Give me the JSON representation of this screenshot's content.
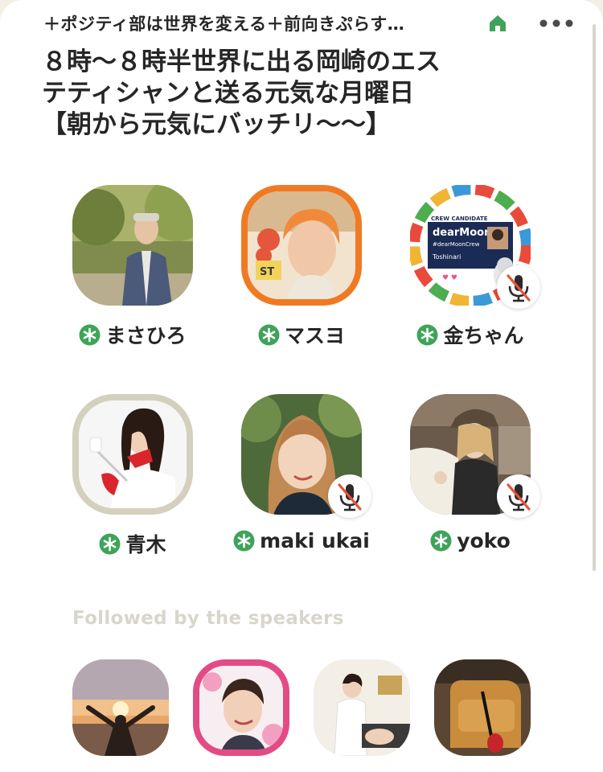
{
  "room": {
    "club_name": "＋ポジティ部は世界を変える＋前向きぷらす…",
    "title_lines": [
      "８時〜８時半世界に出る岡崎のエス",
      "テティシャンと送る元気な月曜日",
      "【朝から元気にバッチリ〜〜】"
    ]
  },
  "speakers": [
    {
      "name": "まさひろ",
      "muted": false
    },
    {
      "name": "マスヨ",
      "muted": false
    },
    {
      "name": "金ちゃん",
      "muted": true
    },
    {
      "name": "青木",
      "muted": false
    },
    {
      "name": "maki ukai",
      "muted": true
    },
    {
      "name": "yoko",
      "muted": true
    }
  ],
  "followed_section": {
    "header": "Followed by the speakers",
    "listener_count_visible": 4
  },
  "colors": {
    "moderator_green": "#3fa35a",
    "text": "#262626",
    "muted_text": "#d8d6cc",
    "background": "#ffffff",
    "mute_red": "#e5533d"
  },
  "icons": {
    "home": "home-icon",
    "more": "more-icon",
    "moderator": "moderator-star-icon",
    "mute": "mic-muted-icon"
  },
  "badges": {
    "sticker_text": "ST",
    "crew_candidate": "CREW CANDIDATE",
    "dear_moon": "dearMoon",
    "hashtag": "#dearMoonCrew",
    "toshinari": "Toshinari"
  }
}
